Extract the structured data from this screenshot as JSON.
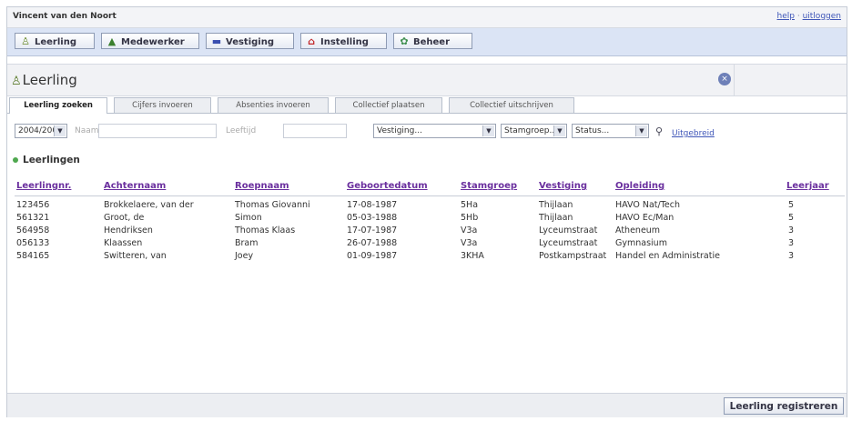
{
  "userbar": {
    "user": "Vincent van den Noort",
    "help": "help",
    "separator": "·",
    "logout": "uitloggen"
  },
  "nav": [
    {
      "label": "Leerling",
      "icon": "person-icon",
      "glyph": "👤",
      "color": "#6a8a2a"
    },
    {
      "label": "Medewerker",
      "icon": "people-icon",
      "glyph": "▲",
      "color": "#3a7f2e"
    },
    {
      "label": "Vestiging",
      "icon": "building-icon",
      "glyph": "▬",
      "color": "#3a4fb0"
    },
    {
      "label": "Instelling",
      "icon": "institution-icon",
      "glyph": "⌂",
      "color": "#c2282a"
    },
    {
      "label": "Beheer",
      "icon": "gears-icon",
      "glyph": "✿",
      "color": "#3f8f4f"
    }
  ],
  "panel": {
    "title": "Leerling",
    "close_icon": "close-icon",
    "close_glyph": "×"
  },
  "tabs": [
    "Leerling zoeken",
    "Cijfers invoeren",
    "Absenties invoeren",
    "Collectief plaatsen",
    "Collectief uitschrijven"
  ],
  "filters": {
    "year": "2004/2005",
    "naam_label": "Naam",
    "leeftijd_label": "Leeftijd",
    "vestiging": "Vestiging...",
    "stamgroep": "Stamgroep...",
    "status": "Status...",
    "uitgebreid": "Uitgebreid"
  },
  "section_title": "Leerlingen",
  "table": {
    "columns": [
      "Leerlingnr.",
      "Achternaam",
      "Roepnaam",
      "Geboortedatum",
      "Stamgroep",
      "Vestiging",
      "Opleiding",
      "Leerjaar"
    ],
    "rows": [
      [
        "123456",
        "Brokkelaere, van der",
        "Thomas Giovanni",
        "17-08-1987",
        "5Ha",
        "Thijlaan",
        "HAVO Nat/Tech",
        "5"
      ],
      [
        "561321",
        "Groot, de",
        "Simon",
        "05-03-1988",
        "5Hb",
        "Thijlaan",
        "HAVO Ec/Man",
        "5"
      ],
      [
        "564958",
        "Hendriksen",
        "Thomas Klaas",
        "17-07-1987",
        "V3a",
        "Lyceumstraat",
        "Atheneum",
        "3"
      ],
      [
        "056133",
        "Klaassen",
        "Bram",
        "26-07-1988",
        "V3a",
        "Lyceumstraat",
        "Gymnasium",
        "3"
      ],
      [
        "584165",
        "Switteren, van",
        "Joey",
        "01-09-1987",
        "3KHA",
        "Postkampstraat",
        "Handel en Administratie",
        "3"
      ]
    ]
  },
  "footer": {
    "register_button": "Leerling registreren"
  },
  "colors": {
    "nav_bg": "#dbe4f5",
    "link": "#3f56b8",
    "header_link": "#6a2f9e",
    "accent_green": "#4fa84f"
  }
}
